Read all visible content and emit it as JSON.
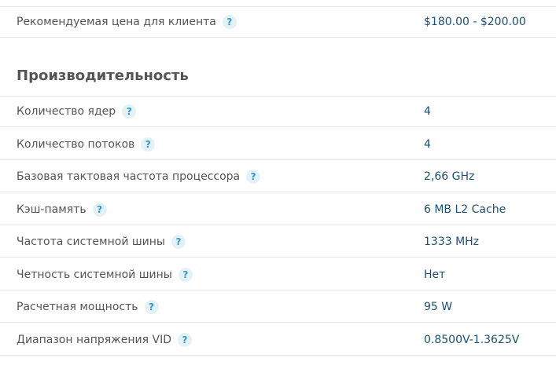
{
  "price_row": {
    "label": "Рекомендуемая цена для клиента",
    "help": "?",
    "value": "$180.00 - $200.00"
  },
  "section": {
    "title": "Производительность"
  },
  "rows": [
    {
      "label": "Количество ядер",
      "help": "?",
      "value": "4"
    },
    {
      "label": "Количество потоков",
      "help": "?",
      "value": "4"
    },
    {
      "label": "Базовая тактовая частота процессора",
      "help": "?",
      "value": "2,66 GHz"
    },
    {
      "label": "Кэш-память",
      "help": "?",
      "value": "6 MB L2 Cache"
    },
    {
      "label": "Частота системной шины",
      "help": "?",
      "value": "1333 MHz"
    },
    {
      "label": "Четность системной шины",
      "help": "?",
      "value": "Нет"
    },
    {
      "label": "Расчетная мощность",
      "help": "?",
      "value": "95 W"
    },
    {
      "label": "Диапазон напряжения VID",
      "help": "?",
      "value": "0.8500V-1.3625V"
    }
  ],
  "colors": {
    "label": "#555555",
    "value": "#1c4f73",
    "help_icon": "#2c9bc9",
    "help_bg": "#e4f2f8",
    "divider": "#e8e8e8"
  }
}
